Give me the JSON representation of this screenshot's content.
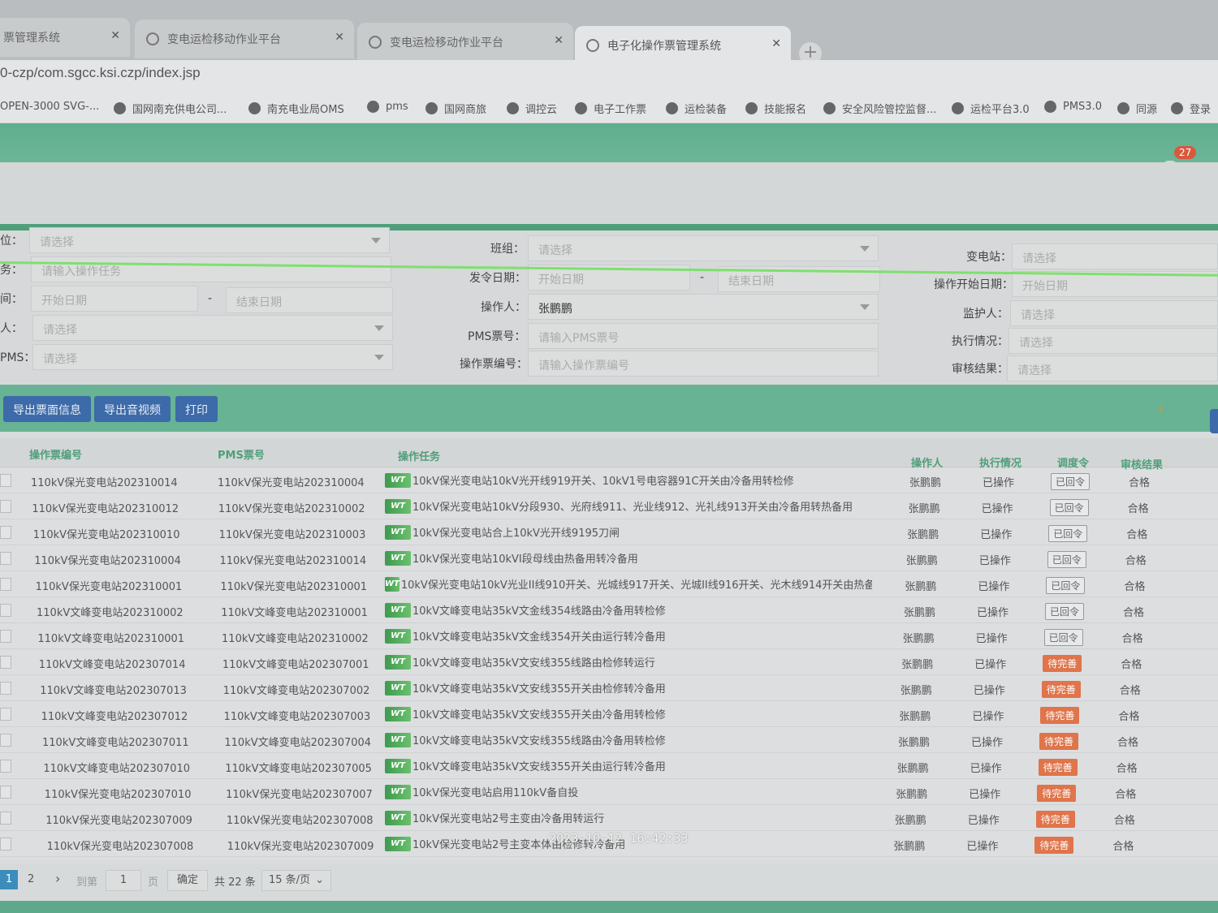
{
  "browser": {
    "tabs": [
      {
        "label": "票管理系统"
      },
      {
        "label": "变电运检移动作业平台"
      },
      {
        "label": "变电运检移动作业平台"
      },
      {
        "label": "电子化操作票管理系统"
      }
    ],
    "new_tab": "+",
    "url": "0-czp/com.sgcc.ksi.czp/index.jsp",
    "bookmarks": [
      "OPEN-3000 SVG-...",
      "国网南充供电公司...",
      "南充电业局OMS",
      "pms",
      "国网商旅",
      "调控云",
      "电子工作票",
      "运检装备",
      "技能报名",
      "安全风险管控监督...",
      "运检平台3.0",
      "PMS3.0",
      "同源",
      "登录"
    ]
  },
  "header": {
    "notification_count": "27"
  },
  "filters": {
    "unit_label": "位：",
    "unit_value": "请选择",
    "team_label": "班组：",
    "team_value": "请选择",
    "station_label": "变电站：",
    "station_value": "请选择",
    "task_label": "务：",
    "task_placeholder": "请输入操作任务",
    "issue_date_label": "发令日期：",
    "issue_start": "开始日期",
    "issue_end": "结束日期",
    "op_start_label": "操作开始日期：",
    "op_start": "开始日期",
    "time_label": "间：",
    "time_start": "开始日期",
    "time_end": "结束日期",
    "operator_label": "操作人：",
    "operator_value": "张鹏鹏",
    "guardian_label": "监护人：",
    "guardian_value": "请选择",
    "person_label": "人：",
    "person_value": "请选择",
    "pms_label": "PMS票号：",
    "pms_placeholder": "请输入PMS票号",
    "exec_label": "执行情况：",
    "exec_value": "请选择",
    "pms2_label": "PMS：",
    "pms2_value": "请选择",
    "ticket_label": "操作票编号：",
    "ticket_placeholder": "请输入操作票编号",
    "audit_label": "审核结果：",
    "audit_value": "请选择"
  },
  "toolbar": {
    "export_ticket": "导出票面信息",
    "export_av": "导出音视频",
    "print": "打印"
  },
  "table": {
    "headers": {
      "ticket": "操作票编号",
      "pms": "PMS票号",
      "task": "操作任务",
      "operator": "操作人",
      "exec": "执行情况",
      "dispatch": "调度令",
      "audit": "审核结果"
    },
    "badge": "WT",
    "rows": [
      {
        "ticket": "110kV保光变电站202310014",
        "pms": "110kV保光变电站202310004",
        "task": "10kV保光变电站10kV光开线919开关、10kV1号电容器91C开关由冷备用转检修",
        "operator": "张鹏鹏",
        "exec": "已操作",
        "dispatch": "已回令",
        "audit": "合格"
      },
      {
        "ticket": "110kV保光变电站202310012",
        "pms": "110kV保光变电站202310002",
        "task": "10kV保光变电站10kV分段930、光府线911、光业线912、光礼线913开关由冷备用转热备用",
        "operator": "张鹏鹏",
        "exec": "已操作",
        "dispatch": "已回令",
        "audit": "合格"
      },
      {
        "ticket": "110kV保光变电站202310010",
        "pms": "110kV保光变电站202310003",
        "task": "10kV保光变电站合上10kV光开线9195刀闸",
        "operator": "张鹏鹏",
        "exec": "已操作",
        "dispatch": "已回令",
        "audit": "合格"
      },
      {
        "ticket": "110kV保光变电站202310004",
        "pms": "110kV保光变电站202310014",
        "task": "10kV保光变电站10kVI段母线由热备用转冷备用",
        "operator": "张鹏鹏",
        "exec": "已操作",
        "dispatch": "已回令",
        "audit": "合格"
      },
      {
        "ticket": "110kV保光变电站202310001",
        "pms": "110kV保光变电站202310001",
        "task": "10kV保光变电站10kV光业II线910开关、光城线917开关、光城II线916开关、光木线914开关由热备...",
        "operator": "张鹏鹏",
        "exec": "已操作",
        "dispatch": "已回令",
        "audit": "合格"
      },
      {
        "ticket": "110kV文峰变电站202310002",
        "pms": "110kV文峰变电站202310001",
        "task": "10kV文峰变电站35kV文金线354线路由冷备用转检修",
        "operator": "张鹏鹏",
        "exec": "已操作",
        "dispatch": "已回令",
        "audit": "合格"
      },
      {
        "ticket": "110kV文峰变电站202310001",
        "pms": "110kV文峰变电站202310002",
        "task": "10kV文峰变电站35kV文金线354开关由运行转冷备用",
        "operator": "张鹏鹏",
        "exec": "已操作",
        "dispatch": "已回令",
        "audit": "合格"
      },
      {
        "ticket": "110kV文峰变电站202307014",
        "pms": "110kV文峰变电站202307001",
        "task": "10kV文峰变电站35kV文安线355线路由检修转运行",
        "operator": "张鹏鹏",
        "exec": "已操作",
        "dispatch": "待完善",
        "audit": "合格"
      },
      {
        "ticket": "110kV文峰变电站202307013",
        "pms": "110kV文峰变电站202307002",
        "task": "10kV文峰变电站35kV文安线355开关由检修转冷备用",
        "operator": "张鹏鹏",
        "exec": "已操作",
        "dispatch": "待完善",
        "audit": "合格"
      },
      {
        "ticket": "110kV文峰变电站202307012",
        "pms": "110kV文峰变电站202307003",
        "task": "10kV文峰变电站35kV文安线355开关由冷备用转检修",
        "operator": "张鹏鹏",
        "exec": "已操作",
        "dispatch": "待完善",
        "audit": "合格"
      },
      {
        "ticket": "110kV文峰变电站202307011",
        "pms": "110kV文峰变电站202307004",
        "task": "10kV文峰变电站35kV文安线355线路由冷备用转检修",
        "operator": "张鹏鹏",
        "exec": "已操作",
        "dispatch": "待完善",
        "audit": "合格"
      },
      {
        "ticket": "110kV文峰变电站202307010",
        "pms": "110kV文峰变电站202307005",
        "task": "10kV文峰变电站35kV文安线355开关由运行转冷备用",
        "operator": "张鹏鹏",
        "exec": "已操作",
        "dispatch": "待完善",
        "audit": "合格"
      },
      {
        "ticket": "110kV保光变电站202307010",
        "pms": "110kV保光变电站202307007",
        "task": "10kV保光变电站启用110kV备自投",
        "operator": "张鹏鹏",
        "exec": "已操作",
        "dispatch": "待完善",
        "audit": "合格"
      },
      {
        "ticket": "110kV保光变电站202307009",
        "pms": "110kV保光变电站202307008",
        "task": "10kV保光变电站2号主变由冷备用转运行",
        "operator": "张鹏鹏",
        "exec": "已操作",
        "dispatch": "待完善",
        "audit": "合格"
      },
      {
        "ticket": "110kV保光变电站202307008",
        "pms": "110kV保光变电站202307009",
        "task": "10kV保光变电站2号主变本体由检修转冷备用",
        "operator": "张鹏鹏",
        "exec": "已操作",
        "dispatch": "待完善",
        "audit": "合格"
      }
    ]
  },
  "timestamp": "2023-10-12 16:42:33",
  "pagination": {
    "current": "1",
    "next": "2",
    "next_arrow": "›",
    "goto_label": "到第",
    "goto_value": "1",
    "page_label": "页",
    "confirm": "确定",
    "total": "共 22 条",
    "page_size": "15 条/页"
  }
}
